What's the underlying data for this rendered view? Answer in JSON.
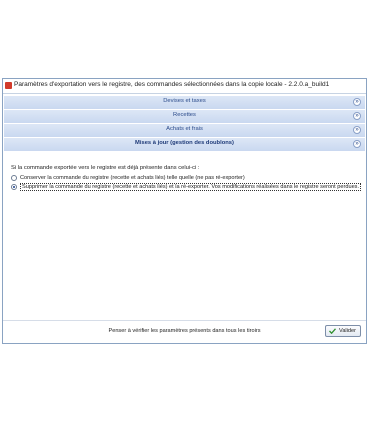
{
  "window": {
    "title": "Paramètres d'exportation vers le registre, des commandes sélectionnées dans la copie locale  - 2.2.0.a_build1"
  },
  "sections": [
    {
      "label": "Devises et taxes",
      "active": false
    },
    {
      "label": "Recettes",
      "active": false
    },
    {
      "label": "Achats et frais",
      "active": false
    },
    {
      "label": "Mises à jour (gestion des doublons)",
      "active": true
    }
  ],
  "content": {
    "question": "Si la commande exportée vers le registre est déjà présente dans celui-ci :",
    "options": [
      {
        "label": "Conserver la commande du registre (recette et achats liés) telle quelle (ne pas ré-exporter)",
        "selected": false
      },
      {
        "label": "Supprimer la commande du registre  (recette et achats liés) et la ré-exporter. Vos modifications réalisées dans le registre seront perdues.",
        "selected": true
      }
    ]
  },
  "footer": {
    "hint": "Penser à vérifier les paramètres présents dans tous les tiroirs",
    "ok_label": "Valider"
  },
  "colors": {
    "section_band": "#c9d8f0",
    "section_text": "#2a4a8a",
    "window_border": "#8aa3c2"
  }
}
